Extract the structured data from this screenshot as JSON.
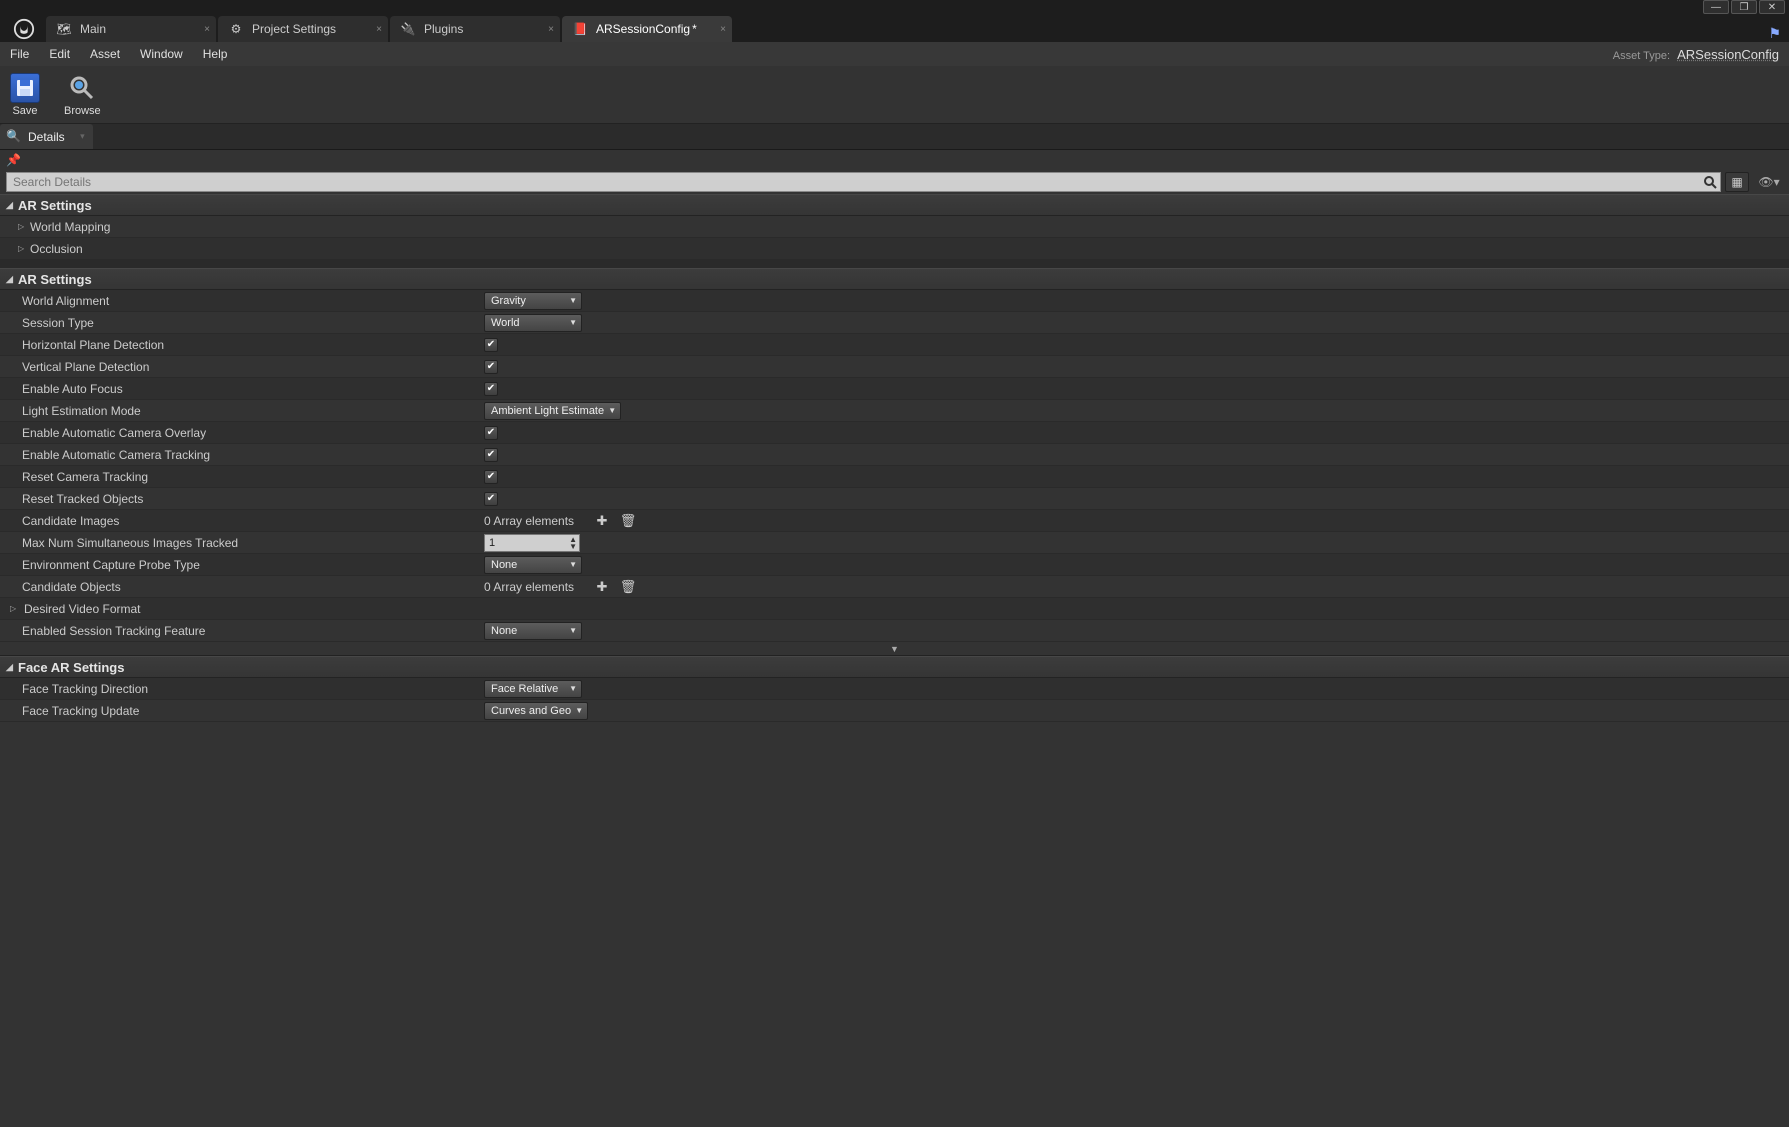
{
  "window": {
    "minimize": "—",
    "maximize": "❐",
    "close": "✕"
  },
  "tabs": [
    {
      "label": "Main",
      "icon": "level"
    },
    {
      "label": "Project Settings",
      "icon": "gear"
    },
    {
      "label": "Plugins",
      "icon": "plug"
    },
    {
      "label": "ARSessionConfig",
      "icon": "asset",
      "modified": "*"
    }
  ],
  "menu": {
    "items": [
      "File",
      "Edit",
      "Asset",
      "Window",
      "Help"
    ],
    "asset_type_label": "Asset Type:",
    "asset_type_value": "ARSessionConfig"
  },
  "toolbar": {
    "save": "Save",
    "browse": "Browse"
  },
  "details_tab": "Details",
  "search_placeholder": "Search Details",
  "sections": {
    "ar_settings_1": {
      "title": "AR Settings",
      "sub": [
        "World Mapping",
        "Occlusion"
      ]
    },
    "ar_settings_2": {
      "title": "AR Settings",
      "props": {
        "world_alignment": {
          "label": "World Alignment",
          "value": "Gravity"
        },
        "session_type": {
          "label": "Session Type",
          "value": "World"
        },
        "horiz_plane": {
          "label": "Horizontal Plane Detection",
          "checked": true
        },
        "vert_plane": {
          "label": "Vertical Plane Detection",
          "checked": true
        },
        "auto_focus": {
          "label": "Enable Auto Focus",
          "checked": true
        },
        "light_est": {
          "label": "Light Estimation Mode",
          "value": "Ambient Light Estimate"
        },
        "cam_overlay": {
          "label": "Enable Automatic Camera Overlay",
          "checked": true
        },
        "cam_tracking": {
          "label": "Enable Automatic Camera Tracking",
          "checked": true
        },
        "reset_cam": {
          "label": "Reset Camera Tracking",
          "checked": true
        },
        "reset_obj": {
          "label": "Reset Tracked Objects",
          "checked": true
        },
        "cand_images": {
          "label": "Candidate Images",
          "array_text": "0 Array elements"
        },
        "max_images": {
          "label": "Max Num Simultaneous Images Tracked",
          "value": "1"
        },
        "env_probe": {
          "label": "Environment Capture Probe Type",
          "value": "None"
        },
        "cand_objects": {
          "label": "Candidate Objects",
          "array_text": "0 Array elements"
        },
        "video_fmt": {
          "label": "Desired Video Format"
        },
        "sess_feature": {
          "label": "Enabled Session Tracking Feature",
          "value": "None"
        }
      }
    },
    "face_ar": {
      "title": "Face AR Settings",
      "props": {
        "face_dir": {
          "label": "Face Tracking Direction",
          "value": "Face Relative"
        },
        "face_update": {
          "label": "Face Tracking Update",
          "value": "Curves and Geo"
        }
      }
    }
  }
}
